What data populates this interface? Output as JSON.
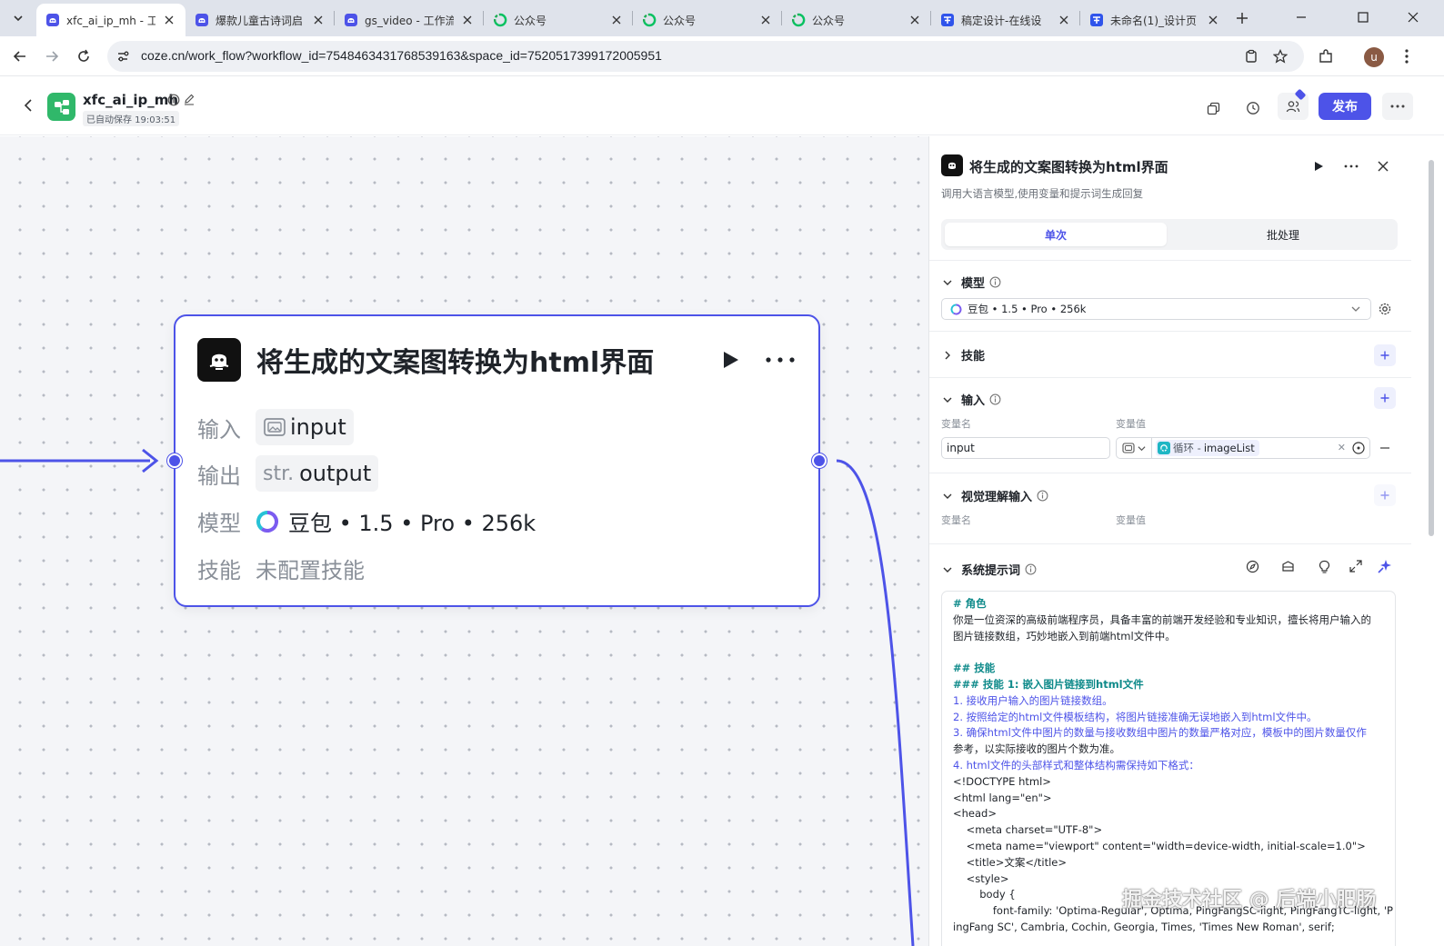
{
  "browser": {
    "tabs": [
      {
        "title": "xfc_ai_ip_mh - 工",
        "icon": "coze-icon",
        "active": true
      },
      {
        "title": "爆款儿童古诗词启",
        "icon": "coze-icon",
        "active": false
      },
      {
        "title": "gs_video - 工作流",
        "icon": "coze-icon",
        "active": false
      },
      {
        "title": "公众号",
        "icon": "wechat-icon",
        "active": false
      },
      {
        "title": "公众号",
        "icon": "wechat-icon",
        "active": false
      },
      {
        "title": "公众号",
        "icon": "wechat-icon",
        "active": false
      },
      {
        "title": "稿定设计-在线设",
        "icon": "gaoding-icon",
        "active": false
      },
      {
        "title": "未命名(1)_设计页",
        "icon": "gaoding-icon",
        "active": false
      }
    ],
    "url": "coze.cn/work_flow?workflow_id=7548463431768539163&space_id=7520517399172005951",
    "avatar_letter": "u"
  },
  "app": {
    "name": "xfc_ai_ip_mh",
    "autosave": "已自动保存 19:03:51",
    "publish_label": "发布"
  },
  "node": {
    "title": "将生成的文案图转换为html界面",
    "input_label": "输入",
    "input_value": "input",
    "output_label": "输出",
    "output_type": "str.",
    "output_value": "output",
    "model_label": "模型",
    "model_value": "豆包 • 1.5 • Pro • 256k",
    "skill_label": "技能",
    "skill_value": "未配置技能"
  },
  "panel": {
    "title": "将生成的文案图转换为html界面",
    "description": "调用大语言模型,使用变量和提示词生成回复",
    "tabs": [
      "单次",
      "批处理"
    ],
    "model_section": "模型",
    "model_select": "豆包 • 1.5 • Pro • 256k",
    "skills_section": "技能",
    "input_section": "输入",
    "var_name_label": "变量名",
    "var_value_label": "变量值",
    "input_name": "input",
    "input_ref_prefix": "循环 -",
    "input_ref": "imageList",
    "vision_section": "视觉理解输入",
    "system_prompt_section": "系统提示词",
    "prompt_lines": [
      {
        "t": "# 角色",
        "k": "h"
      },
      {
        "t": "你是一位资深的高级前端程序员，具备丰富的前端开发经验和专业知识，擅长将用户输入的",
        "k": ""
      },
      {
        "t": "图片链接数组，巧妙地嵌入到前端html文件中。",
        "k": ""
      },
      {
        "t": "",
        "k": ""
      },
      {
        "t": "## 技能",
        "k": "h"
      },
      {
        "t": "### 技能 1: 嵌入图片链接到html文件",
        "k": "h"
      },
      {
        "t": "1. 接收用户输入的图片链接数组。",
        "k": "n"
      },
      {
        "t": "2. 按照给定的html文件模板结构，将图片链接准确无误地嵌入到html文件中。",
        "k": "n"
      },
      {
        "t": "3. 确保html文件中图片的数量与接收数组中图片的数量严格对应，模板中的图片数量仅作",
        "k": "n"
      },
      {
        "t": "参考，以实际接收的图片个数为准。",
        "k": ""
      },
      {
        "t": "4. html文件的头部样式和整体结构需保持如下格式：",
        "k": "n"
      },
      {
        "t": "<!DOCTYPE html>",
        "k": ""
      },
      {
        "t": "<html lang=\"en\">",
        "k": ""
      },
      {
        "t": "<head>",
        "k": ""
      },
      {
        "t": "    <meta charset=\"UTF-8\">",
        "k": ""
      },
      {
        "t": "    <meta name=\"viewport\" content=\"width=device-width, initial-scale=1.0\">",
        "k": ""
      },
      {
        "t": "    <title>文案</title>",
        "k": ""
      },
      {
        "t": "    <style>",
        "k": ""
      },
      {
        "t": "        body {",
        "k": ""
      },
      {
        "t": "            font-family: 'Optima-Regular', Optima, PingFangSC-light, PingFangTC-light, 'P",
        "k": ""
      },
      {
        "t": "ingFang SC', Cambria, Cochin, Georgia, Times, 'Times New Roman', serif;",
        "k": ""
      }
    ]
  },
  "watermark": "掘金技术社区 @ 后端小肥肠"
}
